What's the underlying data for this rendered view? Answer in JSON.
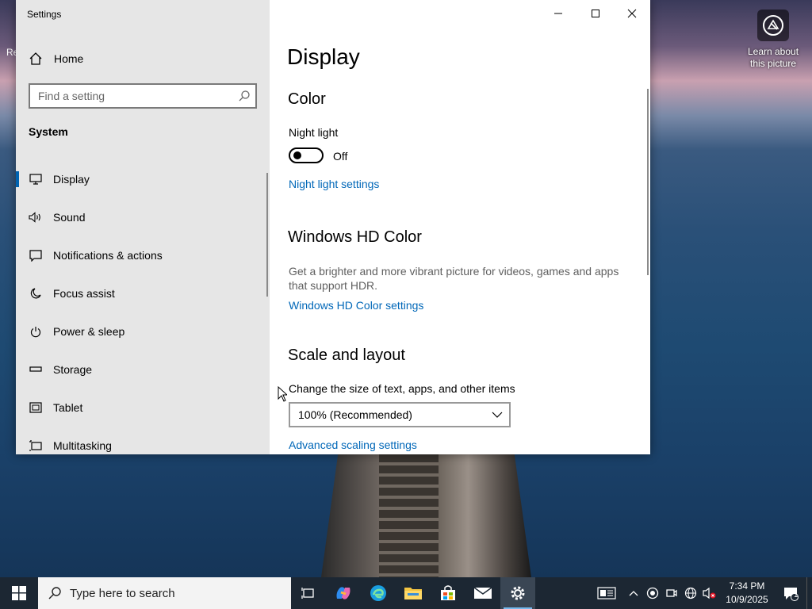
{
  "desktop": {
    "left_icon_label": "Re",
    "learn_about": "Learn about this picture"
  },
  "window": {
    "title": "Settings",
    "controls": {
      "minimize": "minimize",
      "maximize": "maximize",
      "close": "close"
    }
  },
  "sidebar": {
    "home_label": "Home",
    "search_placeholder": "Find a setting",
    "section_title": "System",
    "items": [
      {
        "label": "Display",
        "icon": "monitor-icon",
        "active": true
      },
      {
        "label": "Sound",
        "icon": "speaker-icon"
      },
      {
        "label": "Notifications & actions",
        "icon": "notification-icon"
      },
      {
        "label": "Focus assist",
        "icon": "moon-icon"
      },
      {
        "label": "Power & sleep",
        "icon": "power-icon"
      },
      {
        "label": "Storage",
        "icon": "storage-icon"
      },
      {
        "label": "Tablet",
        "icon": "tablet-icon"
      },
      {
        "label": "Multitasking",
        "icon": "multitasking-icon"
      }
    ]
  },
  "main": {
    "page_title": "Display",
    "color_heading": "Color",
    "night_light_label": "Night light",
    "night_light_state": "Off",
    "night_light_on": false,
    "night_light_link": "Night light settings",
    "hdr_heading": "Windows HD Color",
    "hdr_desc": "Get a brighter and more vibrant picture for videos, games and apps that support HDR.",
    "hdr_link": "Windows HD Color settings",
    "scale_heading": "Scale and layout",
    "scale_label": "Change the size of text, apps, and other items",
    "scale_value": "100% (Recommended)",
    "advanced_link": "Advanced scaling settings"
  },
  "taskbar": {
    "search_placeholder": "Type here to search",
    "apps": [
      "task-view-icon",
      "copilot-icon",
      "edge-icon",
      "file-explorer-icon",
      "store-icon",
      "mail-icon",
      "settings-icon"
    ],
    "clock_time": "7:34 PM",
    "clock_date": "10/9/2025",
    "notification_count": "1"
  },
  "colors": {
    "accent": "#0063b1",
    "link": "#0067b8",
    "sidebar_bg": "#e6e6e6",
    "taskbar_bg": "#1c2733"
  }
}
